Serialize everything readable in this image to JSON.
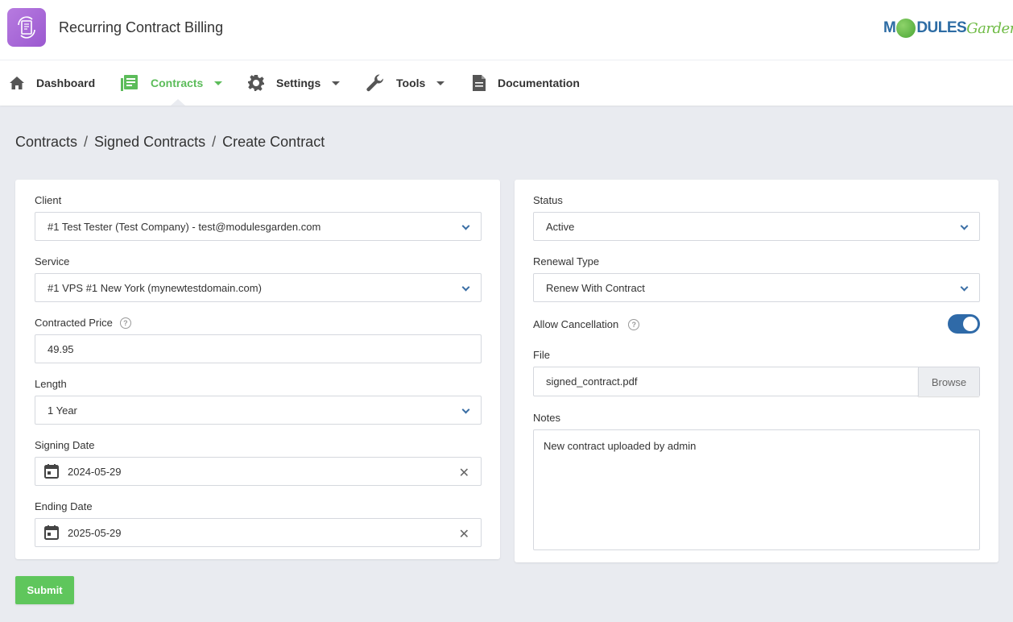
{
  "app": {
    "title": "Recurring Contract Billing",
    "icon": "contract-refresh-icon"
  },
  "logo": {
    "part1": "M",
    "part2": "DULES",
    "part3": "Garden"
  },
  "nav": {
    "dashboard": "Dashboard",
    "contracts": "Contracts",
    "settings": "Settings",
    "tools": "Tools",
    "documentation": "Documentation"
  },
  "breadcrumb": {
    "items": [
      "Contracts",
      "Signed Contracts",
      "Create Contract"
    ],
    "separator": "/"
  },
  "form": {
    "client": {
      "label": "Client",
      "value": "#1 Test Tester (Test Company) - test@modulesgarden.com"
    },
    "service": {
      "label": "Service",
      "value": "#1 VPS #1 New York (mynewtestdomain.com)"
    },
    "contracted_price": {
      "label": "Contracted Price",
      "value": "49.95",
      "help": "?"
    },
    "length": {
      "label": "Length",
      "value": "1 Year"
    },
    "signing_date": {
      "label": "Signing Date",
      "value": "2024-05-29"
    },
    "ending_date": {
      "label": "Ending Date",
      "value": "2025-05-29"
    },
    "status": {
      "label": "Status",
      "value": "Active"
    },
    "renewal_type": {
      "label": "Renewal Type",
      "value": "Renew With Contract"
    },
    "allow_cancellation": {
      "label": "Allow Cancellation",
      "enabled": true,
      "help": "?"
    },
    "file": {
      "label": "File",
      "value": "signed_contract.pdf",
      "browse": "Browse"
    },
    "notes": {
      "label": "Notes",
      "value": "New contract uploaded by admin"
    },
    "clear_glyph": "✕",
    "submit": "Submit"
  },
  "colors": {
    "accent_green": "#5cbc5a",
    "accent_blue": "#2f6aa8",
    "app_icon_purple": "#a869d8"
  }
}
